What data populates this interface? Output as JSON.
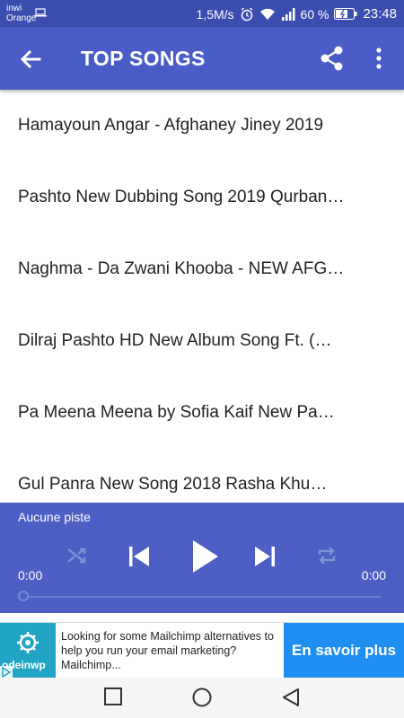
{
  "status_bar": {
    "carrier_1": "inwi",
    "carrier_2": "Orange",
    "speed": "1,5M/s",
    "battery": "60 %",
    "time": "23:48"
  },
  "app_bar": {
    "title": "TOP SONGS",
    "back_icon": "arrow-back-icon",
    "share_icon": "share-icon",
    "more_icon": "more-vert-icon"
  },
  "songs": [
    "Hamayoun Angar  - Afghaney Jiney 2019",
    "Pashto New Dubbing Song 2019 Qurban…",
    "Naghma - Da Zwani Khooba - NEW AFG…",
    "Dilraj Pashto HD New Album Song Ft. (…",
    "Pa Meena Meena by Sofia Kaif   New Pa…",
    "Gul Panra New Song 2018    Rasha Khu…"
  ],
  "player": {
    "track": "Aucune piste",
    "time_elapsed": "0:00",
    "time_total": "0:00",
    "progress": 0
  },
  "ad": {
    "logo_text": "odeinwp",
    "text": "Looking for some Mailchimp alternatives to help you run your email marketing? Mailchimp...",
    "cta": "En savoir plus"
  },
  "colors": {
    "status_bar": "#3b4eb0",
    "app_bar": "#4a5cc6",
    "player": "#4d5fc4",
    "ad_cta": "#1e8ff0"
  }
}
